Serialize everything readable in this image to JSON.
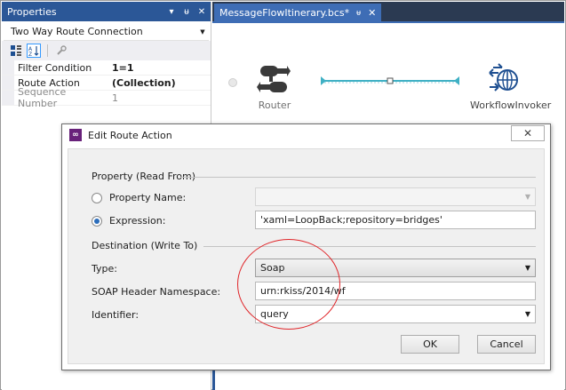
{
  "properties_panel": {
    "title": "Properties",
    "title_icons": [
      "dropdown-arrow-icon",
      "pin-icon",
      "close-icon"
    ],
    "pin_glyph": "ᵾ",
    "close_glyph": "✕",
    "object_selector": "Two Way Route Connection",
    "rows": [
      {
        "name": "Filter Condition",
        "value": "1=1"
      },
      {
        "name": "Route Action",
        "value": "(Collection)"
      },
      {
        "name": "Sequence Number",
        "value": "1"
      }
    ]
  },
  "document_tab": {
    "title": "MessageFlowItinerary.bcs*",
    "pin_glyph": "ᵾ",
    "close_glyph": "✕"
  },
  "canvas": {
    "router_label": "Router",
    "workflow_label": "WorkflowInvoker"
  },
  "dialog": {
    "title": "Edit Route Action",
    "close_glyph": "✕",
    "property_group": "Property (Read From)",
    "property_name_label": "Property Name:",
    "property_name_value": "",
    "expression_label": "Expression:",
    "expression_value": "'xaml=LoopBack;repository=bridges'",
    "destination_group": "Destination (Write To)",
    "type_label": "Type:",
    "type_value": "Soap",
    "namespace_label": "SOAP Header Namespace:",
    "namespace_value": "urn:rkiss/2014/wf",
    "identifier_label": "Identifier:",
    "identifier_value": "query",
    "ok_label": "OK",
    "cancel_label": "Cancel"
  },
  "colors": {
    "title_bar": "#2b5797",
    "tab_active": "#3e6db5",
    "annotation": "#e0262a",
    "connector": "#3fb0c4"
  }
}
